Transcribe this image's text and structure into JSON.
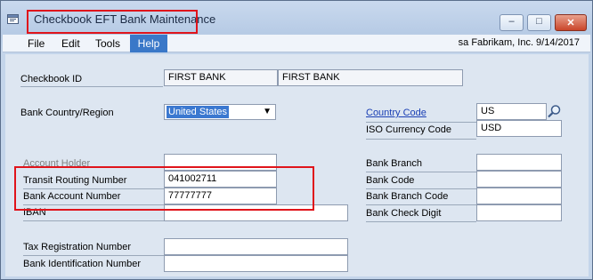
{
  "window": {
    "title": "Checkbook EFT Bank Maintenance"
  },
  "window_controls": {
    "minimize": "–",
    "maximize": "□",
    "close": "✕"
  },
  "menu": {
    "file": "File",
    "edit": "Edit",
    "tools": "Tools",
    "help": "Help"
  },
  "session": {
    "user_info": "sa  Fabrikam, Inc.  9/14/2017"
  },
  "form": {
    "checkbook_id_label": "Checkbook ID",
    "checkbook_id_value": "FIRST BANK",
    "checkbook_desc_value": "FIRST BANK",
    "bank_country_label": "Bank Country/Region",
    "bank_country_value": "United States",
    "country_code_label": "Country Code",
    "country_code_value": "US",
    "iso_currency_label": "ISO Currency Code",
    "iso_currency_value": "USD",
    "account_holder_label": "Account Holder",
    "account_holder_value": "",
    "transit_routing_label": "Transit Routing Number",
    "transit_routing_value": "041002711",
    "bank_account_label": "Bank Account Number",
    "bank_account_value": "77777777",
    "iban_label": "IBAN",
    "iban_value": "",
    "bank_branch_label": "Bank Branch",
    "bank_branch_value": "",
    "bank_code_label": "Bank Code",
    "bank_code_value": "",
    "bank_branch_code_label": "Bank Branch Code",
    "bank_branch_code_value": "",
    "bank_check_digit_label": "Bank Check Digit",
    "bank_check_digit_value": "",
    "tax_registration_label": "Tax Registration Number",
    "tax_registration_value": "",
    "bank_identification_label": "Bank Identification Number",
    "bank_identification_value": ""
  },
  "icons": {
    "app": "app-window-icon",
    "lookup": "magnifier-icon",
    "dropdown": "chevron-down-icon"
  },
  "colors": {
    "highlight": "#e0141b",
    "selection": "#3b78d0",
    "link": "#1a3fb4"
  }
}
